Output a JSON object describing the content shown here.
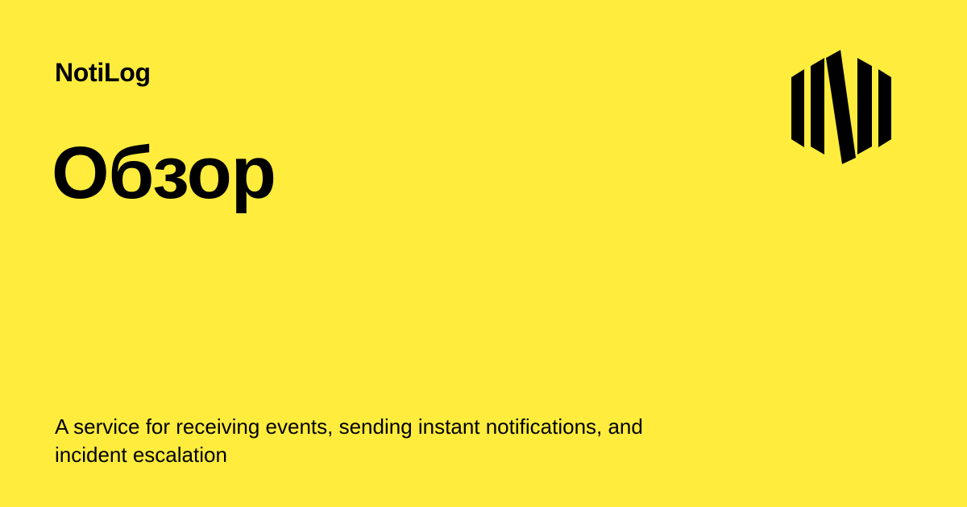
{
  "brand": {
    "name": "NotiLog",
    "logo_icon": "hexagon-n-logo-icon"
  },
  "page": {
    "title": "Обзор",
    "description": "A service for receiving events, sending instant notifications, and incident escalation"
  },
  "colors": {
    "background": "#FFEC3D",
    "foreground": "#000000"
  }
}
